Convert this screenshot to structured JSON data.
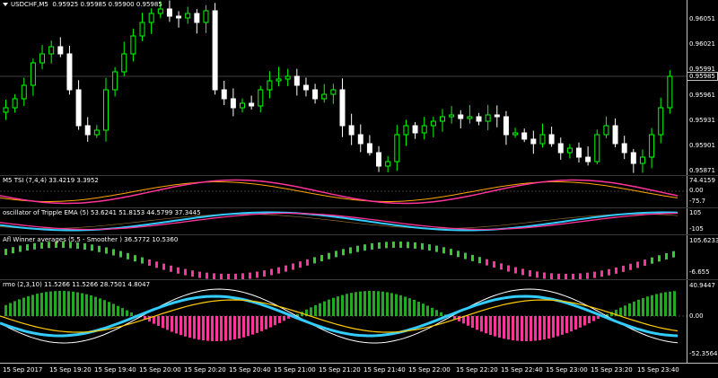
{
  "main": {
    "symbol": "USDCHF,M5",
    "ohlc": "0.95925 0.95985 0.95900 0.95985",
    "price_ticks": [
      "0.96051",
      "0.96021",
      "0.95991",
      "0.95961",
      "0.95931",
      "0.95901",
      "0.95871"
    ],
    "bid_price": "0.95985"
  },
  "indicators": [
    {
      "label": "M5 TSI (7,4,4) 33.4219 3.3952",
      "ticks": [
        "74.4159",
        "0.00",
        "-75.7"
      ]
    },
    {
      "label": "oscillator of Tripple EMA (5) 53.6241 51.8153 44.5799 37.3445",
      "ticks": [
        "105",
        "-105"
      ]
    },
    {
      "label": "Afl Winner averages (5,5 - Smoother ) 36.5772 10.5360",
      "ticks": [
        "105.6233",
        "-6.655"
      ]
    },
    {
      "label": "rmo (2,3,10) 11.5266 11.5266 28.7501 4.8047",
      "ticks": [
        "40.9447",
        "0.00",
        "-52.3564"
      ]
    }
  ],
  "time_labels": [
    "15 Sep 2017",
    "15 Sep 19:20",
    "15 Sep 19:40",
    "15 Sep 20:00",
    "15 Sep 20:20",
    "15 Sep 20:40",
    "15 Sep 21:00",
    "15 Sep 21:20",
    "15 Sep 21:40",
    "15 Sep 22:00",
    "15 Sep 22:20",
    "15 Sep 22:40",
    "15 Sep 23:00",
    "15 Sep 23:20",
    "15 Sep 23:40"
  ],
  "colors": {
    "bull": "#00ff00",
    "bear": "#ffffff",
    "tsi": "#ff3399",
    "signal": "#ffa500",
    "tema": "#33ccff",
    "histo_up": "#33cc33",
    "histo_dn": "#ff3399"
  }
}
